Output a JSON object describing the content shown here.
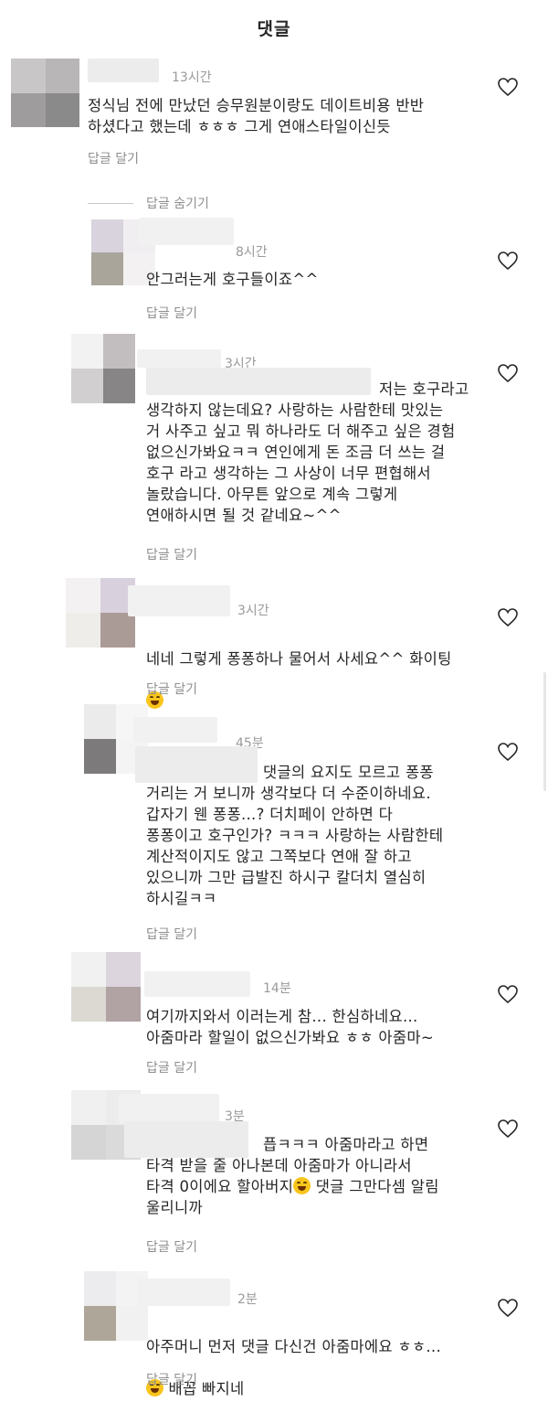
{
  "header": {
    "title": "댓글"
  },
  "hide_replies_label": "답글 숨기기",
  "colors": {
    "text": "#262626",
    "meta": "#9a9a9a",
    "reply": "#8e8e8e",
    "avatar_a": "#c4c0c4",
    "avatar_b": "#8c8c8c"
  },
  "comments": [
    {
      "time": "13시간",
      "text": "정식님 전에 만났던 승무원분이랑도 데이트비용 반반\n하셨다고 했는데 ㅎㅎㅎ 그게 연애스타일이신듯",
      "reply_label": "답글 달기"
    },
    {
      "time": "8시간",
      "text": "안그러는게 호구들이죠^^",
      "reply_label": "답글 달기"
    },
    {
      "time": "3시간",
      "text": "저는 호구라고\n생각하지 않는데요? 사랑하는 사람한테 맛있는\n거 사주고 싶고 뭐 하나라도 더 해주고 싶은 경험\n없으신가봐요ㅋㅋ 연인에게 돈 조금 더 쓰는 걸\n호구 라고 생각하는 그 사상이 너무 편협해서\n놀랐습니다. 아무튼 앞으로 계속 그렇게\n연애하시면 될 것 같네요~^^",
      "reply_label": "답글 달기"
    },
    {
      "time": "3시간",
      "text": "네네 그렇게 퐁퐁하나 물어서 사세요^^ 화이팅",
      "emoji": "grinning-face-emoji",
      "reply_label": "답글 달기"
    },
    {
      "time": "45분",
      "text": "댓글의 요지도 모르고 퐁퐁\n거리는 거 보니까 생각보다 더 수준이하네요.\n갑자기 웬 퐁퐁...? 더치페이 안하면 다\n퐁퐁이고 호구인가? ㅋㅋㅋ 사랑하는 사람한테\n계산적이지도 않고 그쪽보다 연애 잘 하고\n있으니까 그만 급발진 하시구 칼더치 열심히\n하시길ㅋㅋ",
      "reply_label": "답글 달기"
    },
    {
      "time": "14분",
      "text": "여기까지와서 이러는게 참... 한심하네요...\n아줌마라 할일이 없으신가봐요 ㅎㅎ 아줌마~",
      "reply_label": "답글 달기"
    },
    {
      "time": "3분",
      "text": "픕ㅋㅋㅋ 아줌마라고 하면\n타격 받을 줄 아나본데 아줌마가 아니라서\n타격 0이에요 할아버지",
      "text_after_emoji": " 댓글 그만다셈 알림\n울리니까",
      "emoji": "smiling-face-emoji",
      "reply_label": "답글 달기"
    },
    {
      "time": "2분",
      "text": "아주머니 먼저 댓글 다신건 아줌마에요 ㅎㅎ...",
      "text_line2": " 배꼽 빠지네",
      "emoji": "grinning-face-emoji",
      "reply_label": "답글 달기"
    }
  ]
}
